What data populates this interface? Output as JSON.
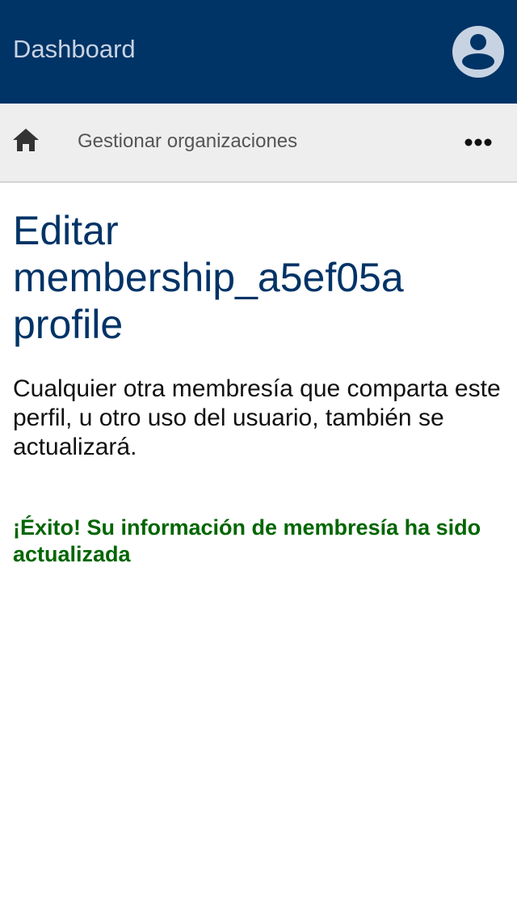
{
  "header": {
    "title": "Dashboard",
    "avatar_icon": "user-circle-icon",
    "background_color": "#003366"
  },
  "subnav": {
    "home_icon": "home-icon",
    "label": "Gestionar organizaciones",
    "more_icon": "more-horizontal-icon"
  },
  "main": {
    "title": "Editar membership_a5ef05a profile",
    "description": "Cualquier otra membresía que comparta este perfil, u otro uso del usuario, también se actualizará.",
    "success_message": "¡Éxito! Su información de membresía ha sido actualizada",
    "success_color": "#006600",
    "title_color": "#003366"
  }
}
